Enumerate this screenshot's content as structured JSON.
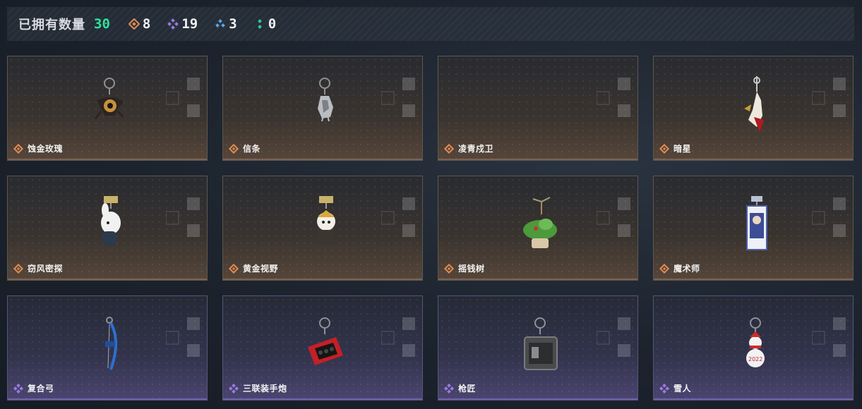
{
  "header": {
    "owned_label": "已拥有数量",
    "owned_total": "30",
    "counts": [
      {
        "icon": "orange-rarity-icon",
        "value": "8",
        "color": "#e08a52"
      },
      {
        "icon": "purple-rarity-icon",
        "value": "19",
        "color": "#9b7be0"
      },
      {
        "icon": "blue-rarity-icon",
        "value": "3",
        "color": "#5aa6e6"
      },
      {
        "icon": "green-rarity-icon",
        "value": "0",
        "color": "#36c99a"
      }
    ]
  },
  "charms": [
    {
      "name": "蚀金玫瑰",
      "rarity": "orange",
      "icon": "gold-rose-charm-icon"
    },
    {
      "name": "信条",
      "rarity": "orange",
      "icon": "creed-charm-icon"
    },
    {
      "name": "凌青戍卫",
      "rarity": "orange",
      "icon": ""
    },
    {
      "name": "暗星",
      "rarity": "orange",
      "icon": "dark-star-charm-icon"
    },
    {
      "name": "窃风密探",
      "rarity": "orange",
      "icon": "wind-spy-charm-icon"
    },
    {
      "name": "黄金视野",
      "rarity": "orange",
      "icon": "golden-vision-charm-icon"
    },
    {
      "name": "摇钱树",
      "rarity": "orange",
      "icon": "money-tree-charm-icon"
    },
    {
      "name": "魔术师",
      "rarity": "orange",
      "icon": "magician-card-charm-icon"
    },
    {
      "name": "复合弓",
      "rarity": "purple",
      "icon": "compound-bow-charm-icon"
    },
    {
      "name": "三联装手炮",
      "rarity": "purple",
      "icon": "hand-cannon-charm-icon"
    },
    {
      "name": "枪匠",
      "rarity": "purple",
      "icon": "gunsmith-case-charm-icon"
    },
    {
      "name": "雪人",
      "rarity": "purple",
      "icon": "snowman-charm-icon"
    }
  ],
  "colors": {
    "orange": "#e08a52",
    "purple": "#9b7be0",
    "accent_green": "#2fe39a"
  }
}
